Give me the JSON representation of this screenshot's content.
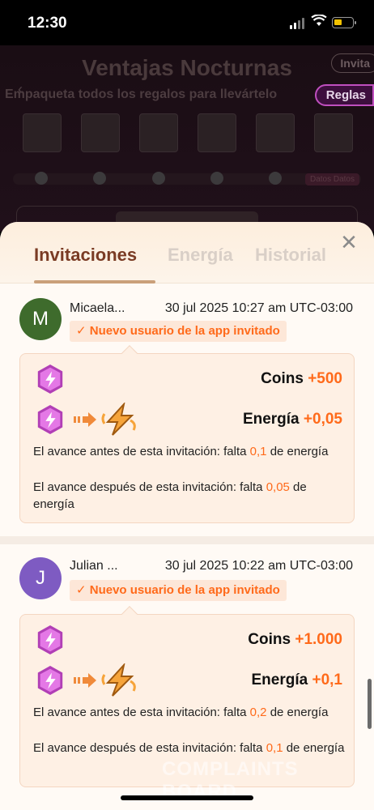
{
  "status_bar": {
    "time": "12:30"
  },
  "background": {
    "title": "Ventajas Nocturnas",
    "invite_label": "Invita",
    "subtitle": "Empaqueta todos los regalos para llevártelo",
    "rules_label": "Reglas",
    "extra_label": "Datos Datos"
  },
  "sheet": {
    "tabs": [
      {
        "label": "Invitaciones",
        "active": true
      },
      {
        "label": "Energía",
        "active": false
      },
      {
        "label": "Historial",
        "active": false
      }
    ],
    "close_label": "✕"
  },
  "entries": [
    {
      "avatar_letter": "M",
      "avatar_color": "#3e6b2c",
      "name": "Micaela...",
      "date": "30 jul 2025 10:27 am UTC-03:00",
      "badge": "✓ Nuevo usuario de la app invitado",
      "coins_label": "Coins",
      "coins_value": "+500",
      "energy_label": "Energía",
      "energy_value": "+0,05",
      "before_text_1": "El avance antes de esta invitación: falta ",
      "before_value": "0,1",
      "before_text_2": " de energía",
      "after_text_1": "El avance después de esta invitación: falta ",
      "after_value": "0,05",
      "after_text_2": " de energía"
    },
    {
      "avatar_letter": "J",
      "avatar_color": "#7e5bc2",
      "name": "Julian ...",
      "date": "30 jul 2025 10:22 am UTC-03:00",
      "badge": "✓ Nuevo usuario de la app invitado",
      "coins_label": "Coins",
      "coins_value": "+1.000",
      "energy_label": "Energía",
      "energy_value": "+0,1",
      "before_text_1": "El avance antes de esta invitación: falta ",
      "before_value": "0,2",
      "before_text_2": " de energía",
      "after_text_1": "El avance después de esta invitación: falta ",
      "after_value": "0,1",
      "after_text_2": " de energía"
    }
  ],
  "watermark": "COMPLAINTS BOARD",
  "colors": {
    "accent": "#ff6a1a",
    "tab_active": "#7a3b24",
    "card_bg": "#fef0e4"
  }
}
